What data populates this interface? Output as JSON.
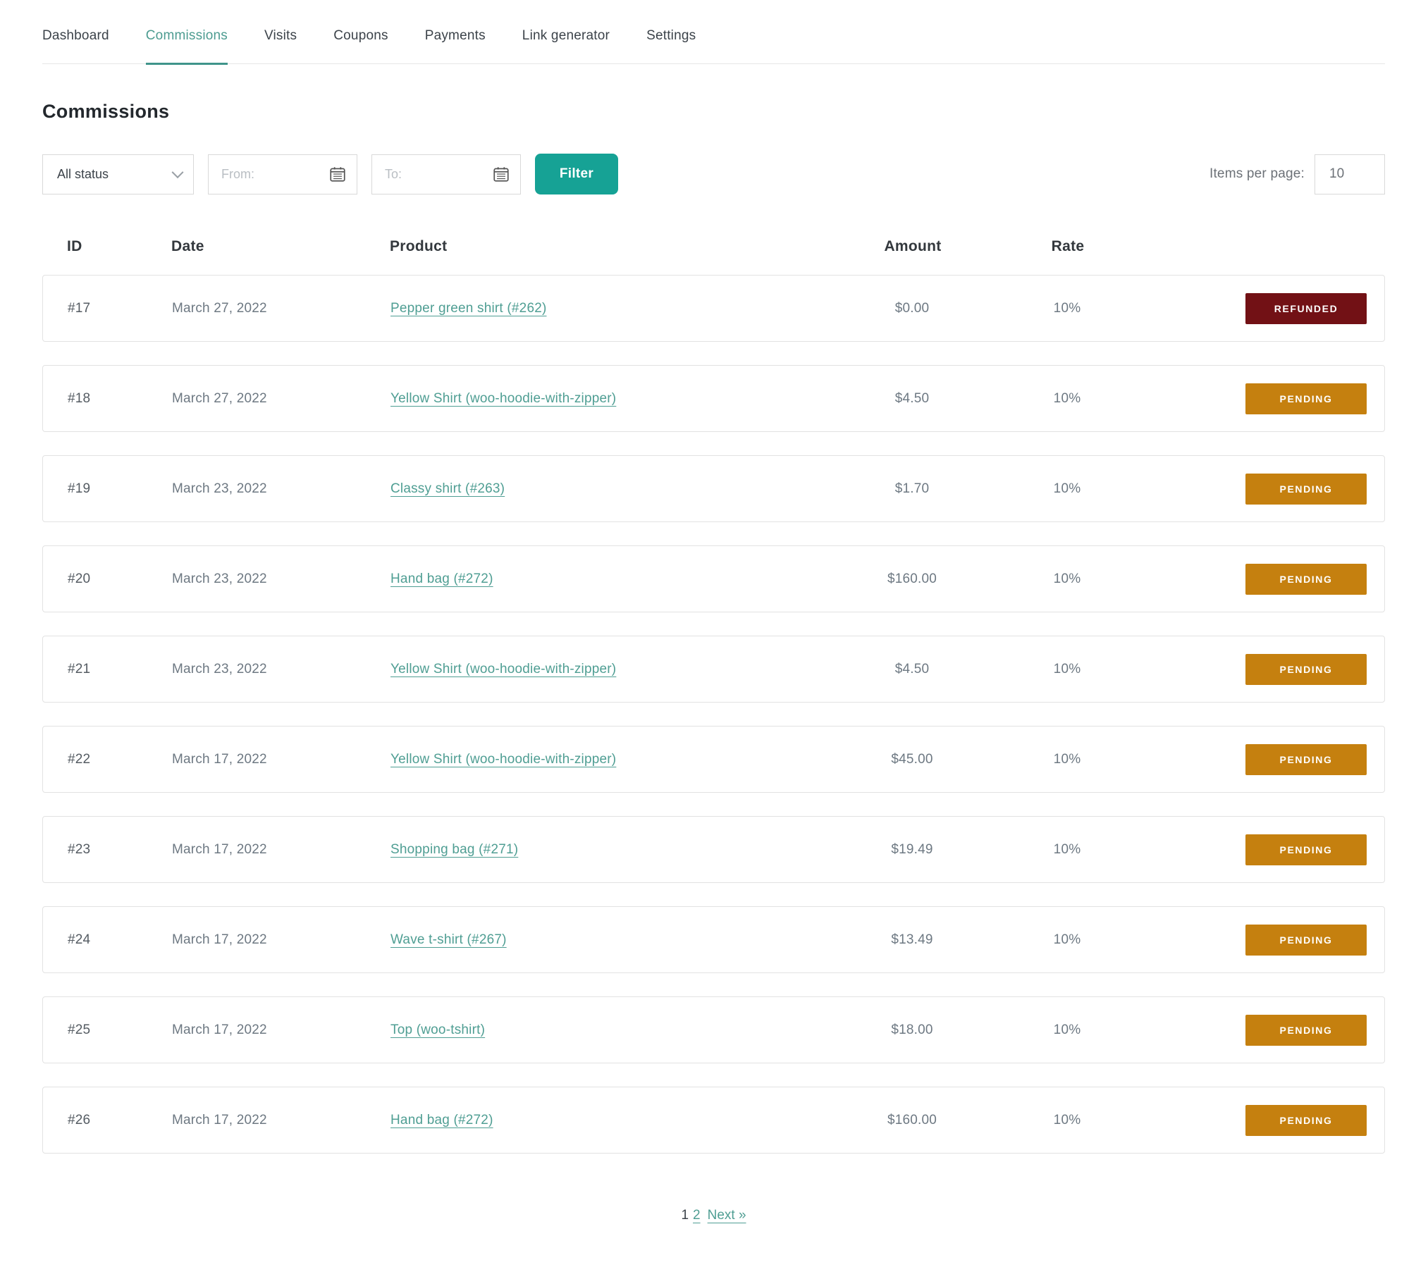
{
  "nav": {
    "tabs": [
      {
        "label": "Dashboard",
        "active": false
      },
      {
        "label": "Commissions",
        "active": true
      },
      {
        "label": "Visits",
        "active": false
      },
      {
        "label": "Coupons",
        "active": false
      },
      {
        "label": "Payments",
        "active": false
      },
      {
        "label": "Link generator",
        "active": false
      },
      {
        "label": "Settings",
        "active": false
      }
    ]
  },
  "page": {
    "title": "Commissions"
  },
  "filters": {
    "status_value": "All status",
    "from_placeholder": "From:",
    "to_placeholder": "To:",
    "filter_label": "Filter",
    "items_per_page_label": "Items per page:",
    "items_per_page_value": "10"
  },
  "table": {
    "headers": {
      "id": "ID",
      "date": "Date",
      "product": "Product",
      "amount": "Amount",
      "rate": "Rate"
    },
    "rows": [
      {
        "id": "#17",
        "date": "March 27, 2022",
        "product": "Pepper green shirt (#262)",
        "amount": "$0.00",
        "rate": "10%",
        "status": "REFUNDED",
        "status_type": "refunded"
      },
      {
        "id": "#18",
        "date": "March 27, 2022",
        "product": "Yellow Shirt (woo-hoodie-with-zipper)",
        "amount": "$4.50",
        "rate": "10%",
        "status": "PENDING",
        "status_type": "pending"
      },
      {
        "id": "#19",
        "date": "March 23, 2022",
        "product": "Classy shirt (#263)",
        "amount": "$1.70",
        "rate": "10%",
        "status": "PENDING",
        "status_type": "pending"
      },
      {
        "id": "#20",
        "date": "March 23, 2022",
        "product": "Hand bag (#272)",
        "amount": "$160.00",
        "rate": "10%",
        "status": "PENDING",
        "status_type": "pending"
      },
      {
        "id": "#21",
        "date": "March 23, 2022",
        "product": "Yellow Shirt (woo-hoodie-with-zipper)",
        "amount": "$4.50",
        "rate": "10%",
        "status": "PENDING",
        "status_type": "pending"
      },
      {
        "id": "#22",
        "date": "March 17, 2022",
        "product": "Yellow Shirt (woo-hoodie-with-zipper)",
        "amount": "$45.00",
        "rate": "10%",
        "status": "PENDING",
        "status_type": "pending"
      },
      {
        "id": "#23",
        "date": "March 17, 2022",
        "product": "Shopping bag (#271)",
        "amount": "$19.49",
        "rate": "10%",
        "status": "PENDING",
        "status_type": "pending"
      },
      {
        "id": "#24",
        "date": "March 17, 2022",
        "product": "Wave t-shirt (#267)",
        "amount": "$13.49",
        "rate": "10%",
        "status": "PENDING",
        "status_type": "pending"
      },
      {
        "id": "#25",
        "date": "March 17, 2022",
        "product": "Top (woo-tshirt)",
        "amount": "$18.00",
        "rate": "10%",
        "status": "PENDING",
        "status_type": "pending"
      },
      {
        "id": "#26",
        "date": "March 17, 2022",
        "product": "Hand bag (#272)",
        "amount": "$160.00",
        "rate": "10%",
        "status": "PENDING",
        "status_type": "pending"
      }
    ]
  },
  "pagination": {
    "current": "1",
    "page2": "2",
    "next": "Next »"
  },
  "colors": {
    "accent_teal": "#16a295",
    "active_tab": "#4d9c91",
    "link": "#4f9e93",
    "pending_badge": "#c5800f",
    "refunded_badge": "#721115"
  }
}
